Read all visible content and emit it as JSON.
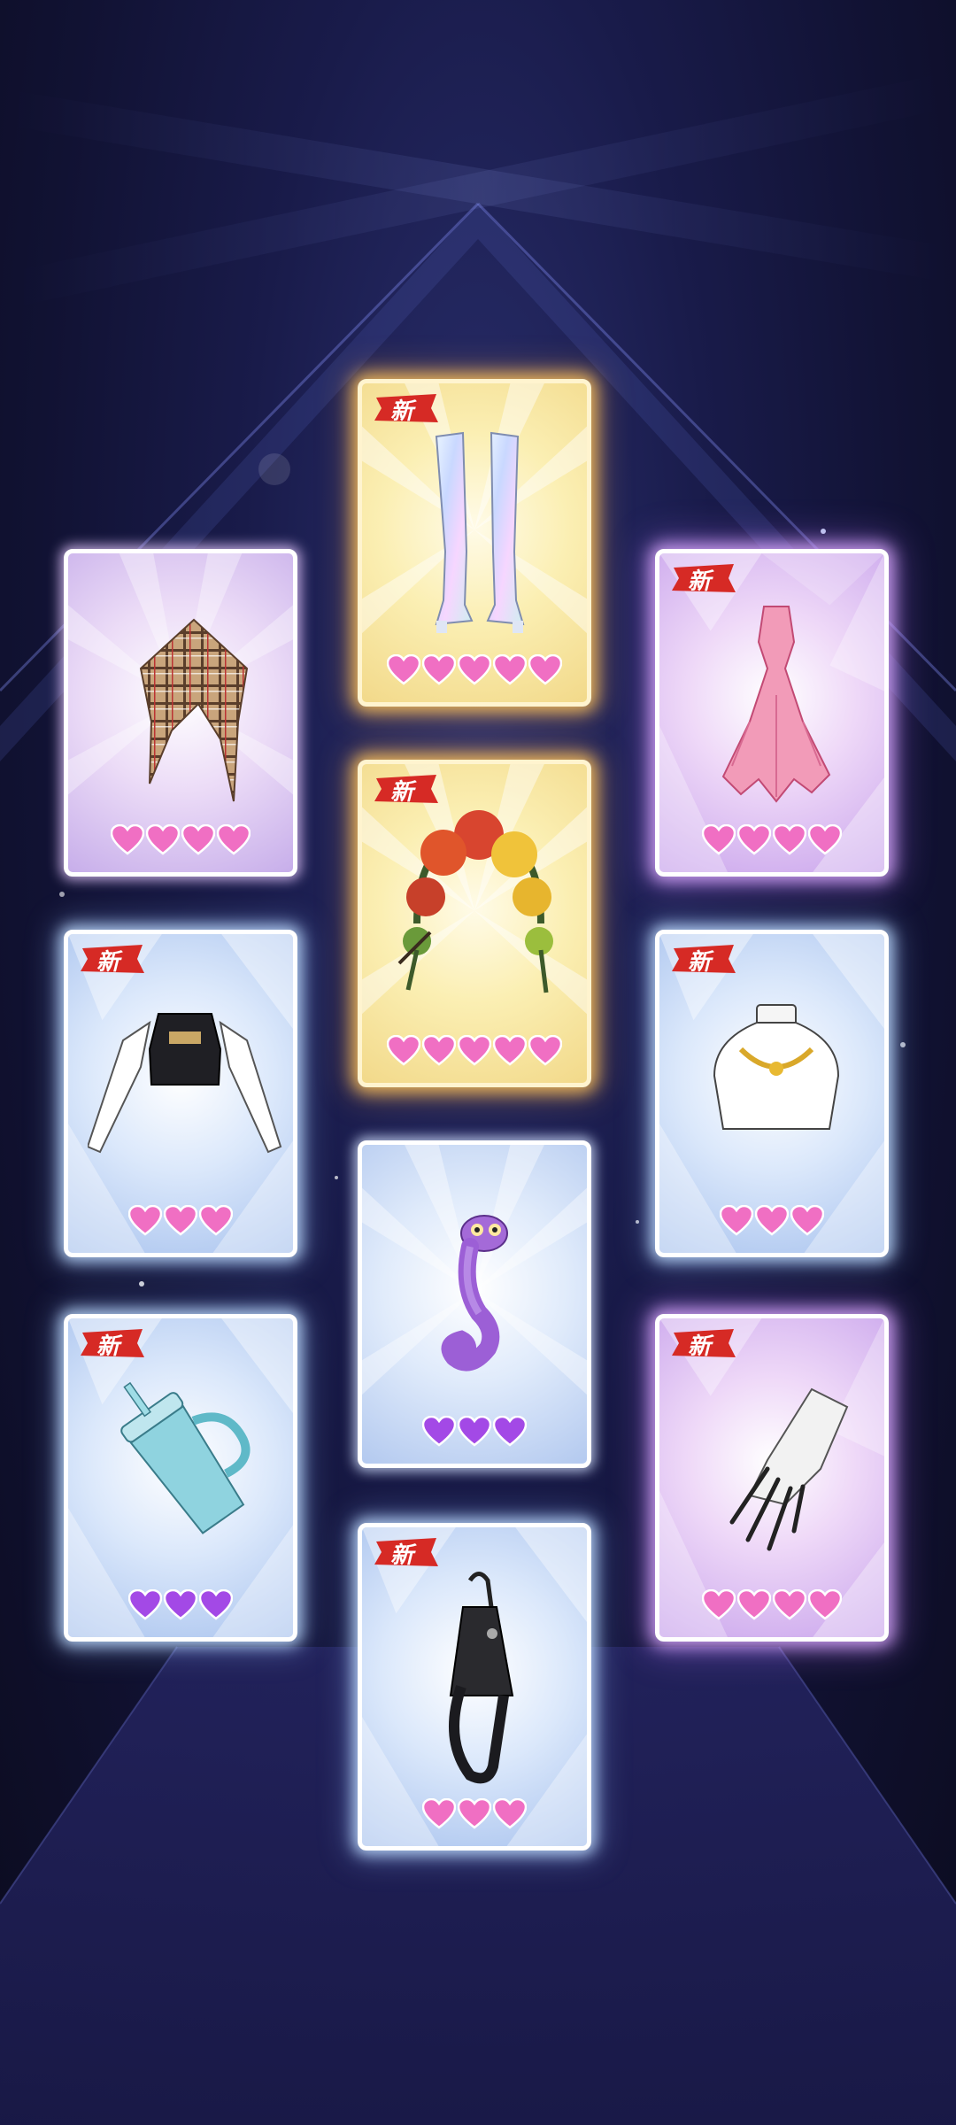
{
  "labels": {
    "new_badge": "新"
  },
  "colors": {
    "heart_pink": "#f06fc3",
    "heart_purple": "#a349e6",
    "gold_glow": "#ffc45a",
    "purple_glow": "#dcaaff",
    "blue_glow": "#bedcff",
    "badge_red": "#d62a25"
  },
  "cards": [
    {
      "item": "plaid-scarf",
      "frame": "plain-purple",
      "is_new": false,
      "rarity": 4,
      "heart_color": "pink"
    },
    {
      "item": "holographic-thigh-high-boots",
      "frame": "gold",
      "is_new": true,
      "rarity": 5,
      "heart_color": "pink"
    },
    {
      "item": "pink-feather-gown",
      "frame": "purple",
      "is_new": true,
      "rarity": 4,
      "heart_color": "pink"
    },
    {
      "item": "crop-top-with-sleeves",
      "frame": "blue",
      "is_new": true,
      "rarity": 3,
      "heart_color": "pink"
    },
    {
      "item": "rose-flower-headdress",
      "frame": "gold",
      "is_new": true,
      "rarity": 5,
      "heart_color": "pink"
    },
    {
      "item": "gold-necklace",
      "frame": "blue",
      "is_new": true,
      "rarity": 3,
      "heart_color": "pink"
    },
    {
      "item": "purple-chameleon",
      "frame": "plain-blue",
      "is_new": false,
      "rarity": 3,
      "heart_color": "purple"
    },
    {
      "item": "tumbler-cup",
      "frame": "blue",
      "is_new": true,
      "rarity": 3,
      "heart_color": "purple"
    },
    {
      "item": "black-nail-claws",
      "frame": "purple",
      "is_new": true,
      "rarity": 4,
      "heart_color": "pink"
    },
    {
      "item": "black-crossbody-bag",
      "frame": "blue",
      "is_new": true,
      "rarity": 3,
      "heart_color": "pink"
    }
  ]
}
